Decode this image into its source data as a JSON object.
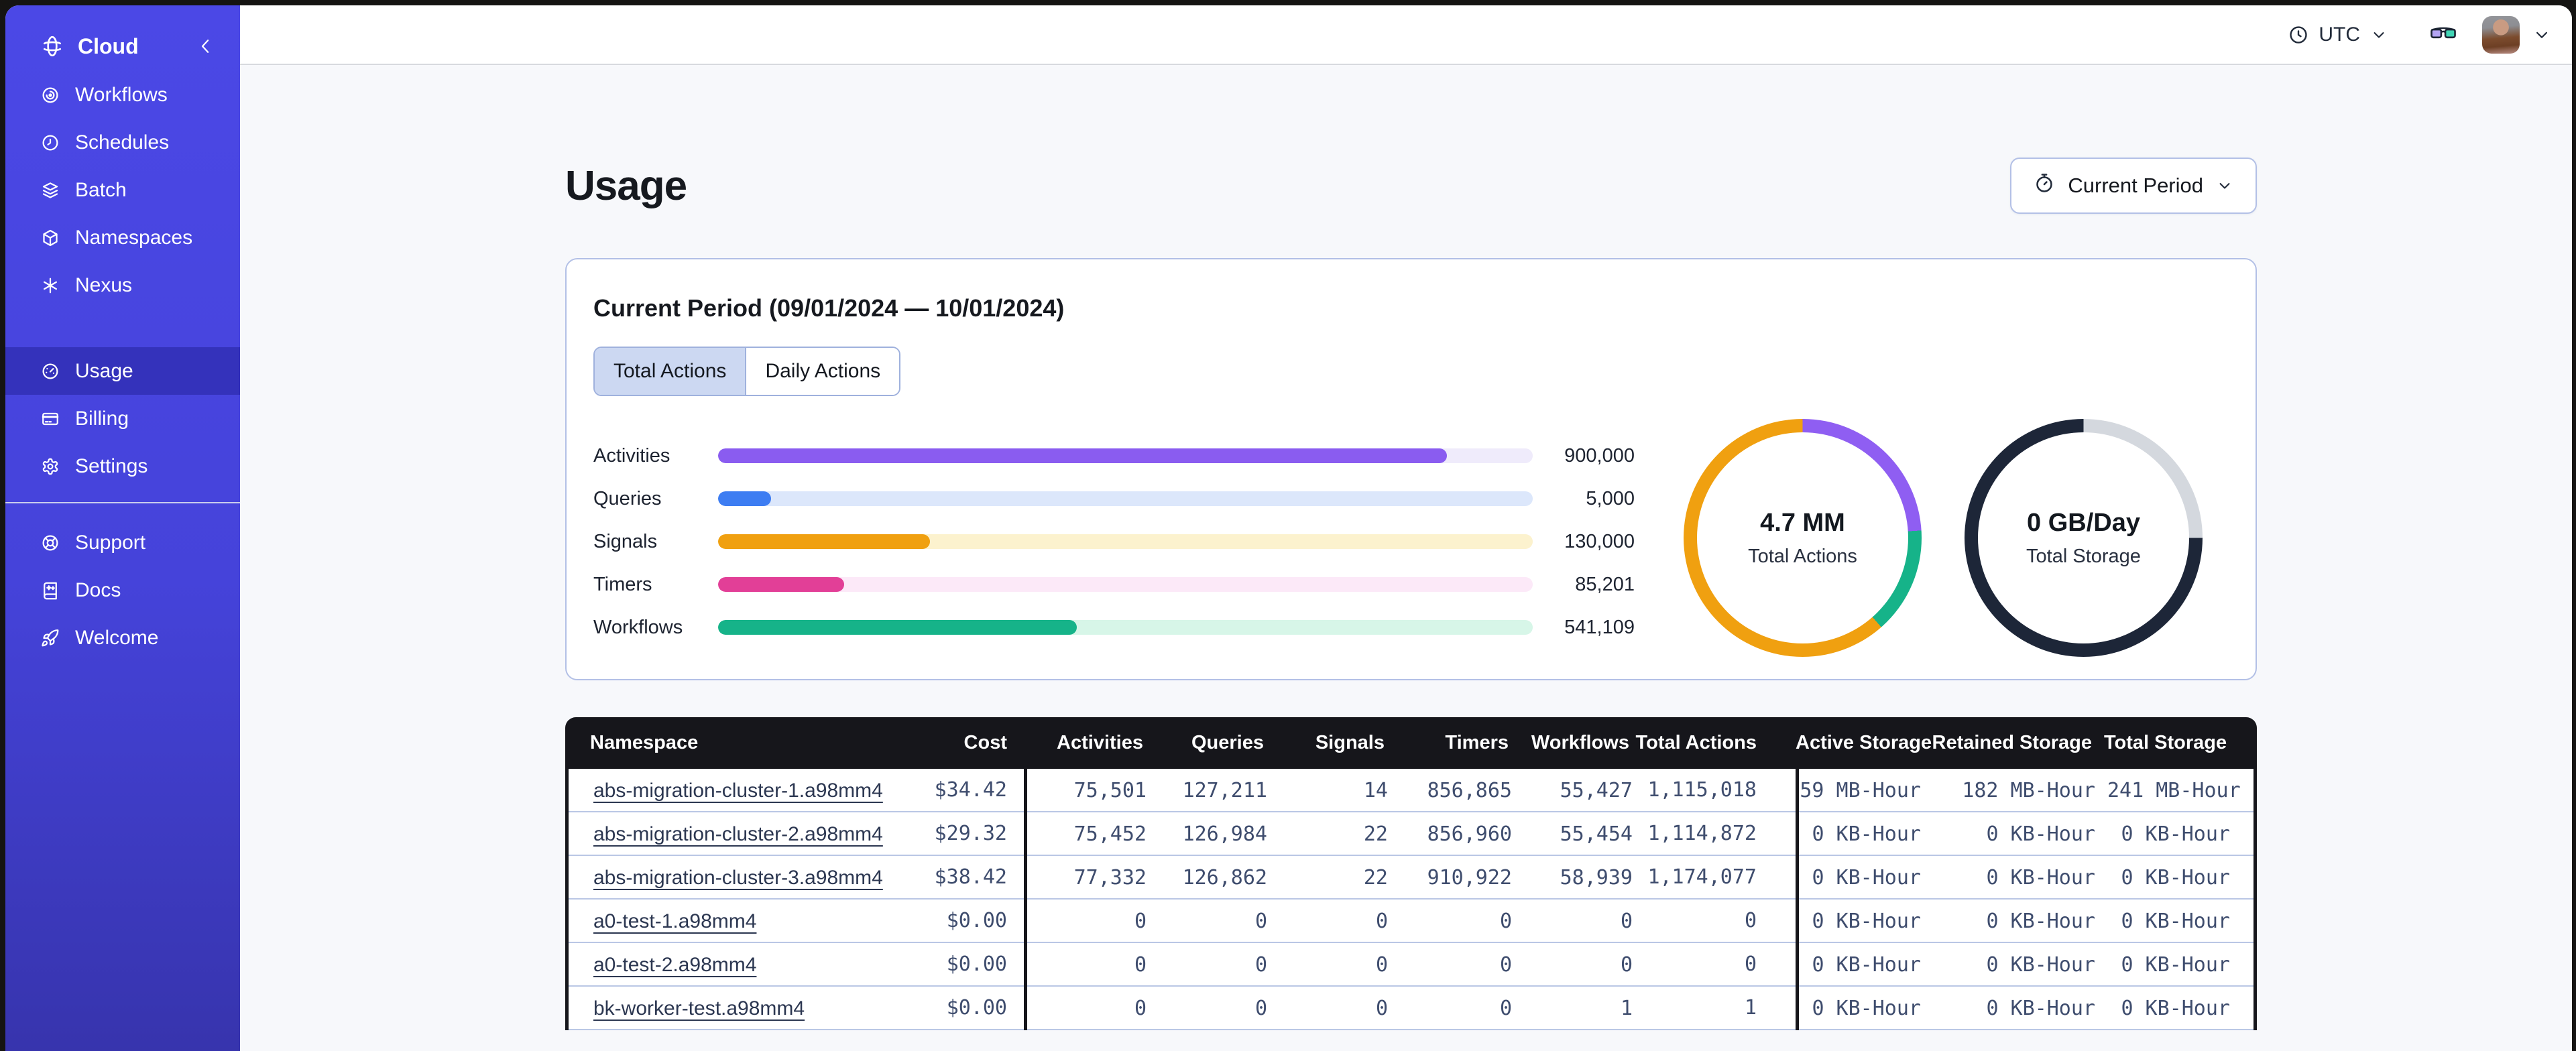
{
  "sidebar": {
    "brand": {
      "label": "Cloud",
      "icon": "temporal-logo-icon",
      "collapse_icon": "chevron-left-icon"
    },
    "nav_main": [
      {
        "label": "Workflows",
        "icon": "workflows-target-icon",
        "active": false
      },
      {
        "label": "Schedules",
        "icon": "schedule-clock-icon",
        "active": false
      },
      {
        "label": "Batch",
        "icon": "layers-icon",
        "active": false
      },
      {
        "label": "Namespaces",
        "icon": "cube-icon",
        "active": false
      },
      {
        "label": "Nexus",
        "icon": "asterisk-icon",
        "active": false
      }
    ],
    "nav_account": [
      {
        "label": "Usage",
        "icon": "gauge-icon",
        "active": true
      },
      {
        "label": "Billing",
        "icon": "credit-card-icon",
        "active": false
      },
      {
        "label": "Settings",
        "icon": "gear-icon",
        "active": false
      }
    ],
    "nav_footer": [
      {
        "label": "Support",
        "icon": "lifebuoy-icon",
        "active": false
      },
      {
        "label": "Docs",
        "icon": "book-icon",
        "active": false
      },
      {
        "label": "Welcome",
        "icon": "rocket-icon",
        "active": false
      }
    ],
    "colors": {
      "bg_top": "#4b48e6",
      "bg_bottom": "#3734ad",
      "active_bg": "rgba(10,8,105,0.30)"
    }
  },
  "topbar": {
    "timezone_label": "UTC"
  },
  "page": {
    "title": "Usage",
    "period_selector": {
      "label": "Current Period",
      "icon": "stopwatch-icon"
    }
  },
  "usage_card": {
    "title": "Current Period (09/01/2024 — 10/01/2024)",
    "tabs": [
      {
        "label": "Total Actions",
        "active": true
      },
      {
        "label": "Daily Actions",
        "active": false
      }
    ],
    "chart_data": {
      "type": "bar",
      "categories": [
        "Activities",
        "Queries",
        "Signals",
        "Timers",
        "Workflows"
      ],
      "values": [
        900000,
        5000,
        130000,
        85201,
        541109
      ],
      "display_values": [
        "900,000",
        "5,000",
        "130,000",
        "85,201",
        "541,109"
      ],
      "fill_percents": [
        89.5,
        6.5,
        26,
        15.5,
        44
      ],
      "bar_colors": [
        "#8a5cf0",
        "#3d7df2",
        "#f0a010",
        "#e23f97",
        "#16b389"
      ],
      "track_colors": [
        "#efebfb",
        "#dce7fb",
        "#fcf2ce",
        "#fce9f8",
        "#d7f6e8"
      ]
    },
    "donuts": [
      {
        "value": "4.7 MM",
        "label": "Total Actions",
        "segments": [
          {
            "name": "activities",
            "color": "#8f5ef2",
            "pct": 24
          },
          {
            "name": "workflows",
            "color": "#16b389",
            "pct": 14.5
          },
          {
            "name": "other-actions",
            "color": "#f0a010",
            "pct": 61.5
          }
        ]
      },
      {
        "value": "0 GB/Day",
        "label": "Total Storage",
        "segments": [
          {
            "name": "storage-empty",
            "color": "#d4d8de",
            "pct": 25
          },
          {
            "name": "storage-track",
            "color": "#1d2638",
            "pct": 75
          }
        ]
      }
    ]
  },
  "table": {
    "columns": [
      "Namespace",
      "Cost",
      "Activities",
      "Queries",
      "Signals",
      "Timers",
      "Workflows",
      "Total Actions",
      "Active Storage",
      "Retained Storage",
      "Total Storage"
    ],
    "rows": [
      [
        "abs-migration-cluster-1.a98mm4",
        "$34.42",
        "75,501",
        "127,211",
        "14",
        "856,865",
        "55,427",
        "1,115,018",
        "59 MB-Hour",
        "182 MB-Hour",
        "241 MB-Hour"
      ],
      [
        "abs-migration-cluster-2.a98mm4",
        "$29.32",
        "75,452",
        "126,984",
        "22",
        "856,960",
        "55,454",
        "1,114,872",
        "0 KB-Hour",
        "0 KB-Hour",
        "0 KB-Hour"
      ],
      [
        "abs-migration-cluster-3.a98mm4",
        "$38.42",
        "77,332",
        "126,862",
        "22",
        "910,922",
        "58,939",
        "1,174,077",
        "0 KB-Hour",
        "0 KB-Hour",
        "0 KB-Hour"
      ],
      [
        "a0-test-1.a98mm4",
        "$0.00",
        "0",
        "0",
        "0",
        "0",
        "0",
        "0",
        "0 KB-Hour",
        "0 KB-Hour",
        "0 KB-Hour"
      ],
      [
        "a0-test-2.a98mm4",
        "$0.00",
        "0",
        "0",
        "0",
        "0",
        "0",
        "0",
        "0 KB-Hour",
        "0 KB-Hour",
        "0 KB-Hour"
      ],
      [
        "bk-worker-test.a98mm4",
        "$0.00",
        "0",
        "0",
        "0",
        "0",
        "1",
        "1",
        "0 KB-Hour",
        "0 KB-Hour",
        "0 KB-Hour"
      ]
    ]
  }
}
